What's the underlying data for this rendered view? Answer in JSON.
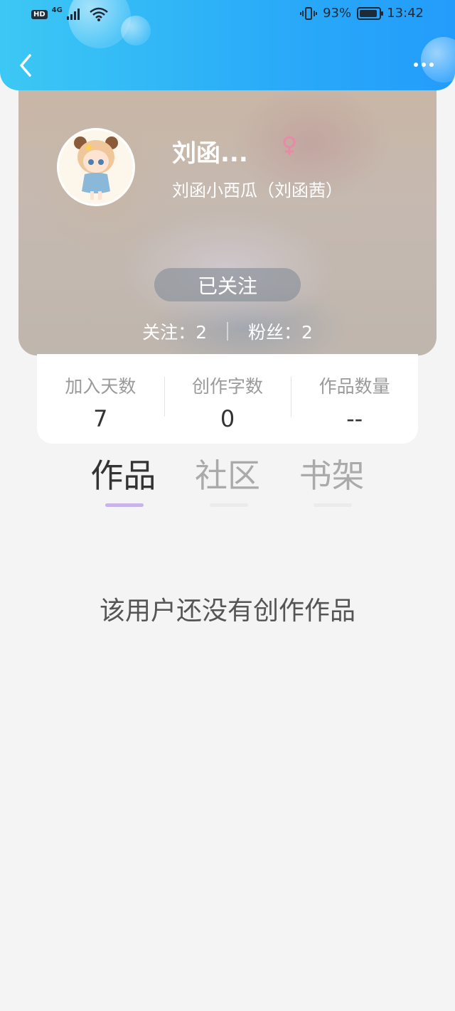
{
  "status_bar": {
    "hd": "HD",
    "network": "4G",
    "battery_percent": "93%",
    "time": "13:42"
  },
  "header": {
    "gradient_colors": [
      "#3cc8f4",
      "#239cfb"
    ]
  },
  "profile": {
    "name": "刘函...",
    "gender": "female",
    "nickname": "刘函小西瓜（刘函茜）",
    "follow_status": "已关注",
    "following": "关注：2",
    "followers": "粉丝：2"
  },
  "stats": [
    {
      "label": "加入天数",
      "value": "7"
    },
    {
      "label": "创作字数",
      "value": "0"
    },
    {
      "label": "作品数量",
      "value": "--"
    }
  ],
  "tabs": [
    {
      "label": "作品",
      "active": true
    },
    {
      "label": "社区",
      "active": false
    },
    {
      "label": "书架",
      "active": false
    }
  ],
  "empty_message": "该用户还没有创作作品",
  "colors": {
    "accent": "#c8b4e8",
    "female_icon": "#e88aa6",
    "page_bg": "#f4f4f4"
  }
}
